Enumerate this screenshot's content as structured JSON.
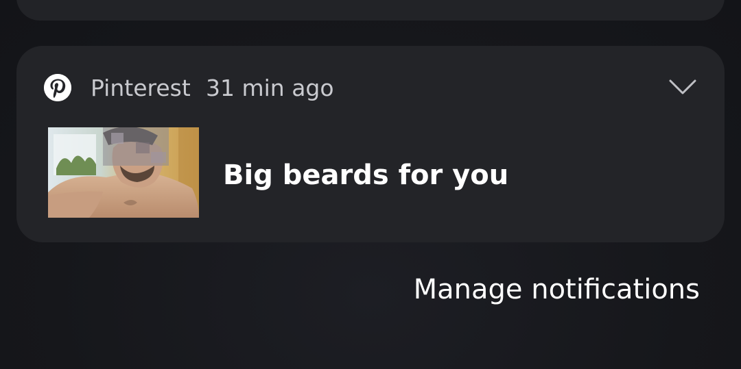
{
  "notification": {
    "app_name": "Pinterest",
    "time": "31 min ago",
    "title": "Big beards for you",
    "icon": "pinterest-logo-icon",
    "expand_icon": "chevron-down-icon",
    "thumbnail": "photo-thumbnail"
  },
  "footer": {
    "manage_label": "Manage notifications"
  },
  "colors": {
    "background": "#17181c",
    "card": "#232428",
    "secondary_text": "#c9cacf",
    "primary_text": "#ffffff"
  }
}
